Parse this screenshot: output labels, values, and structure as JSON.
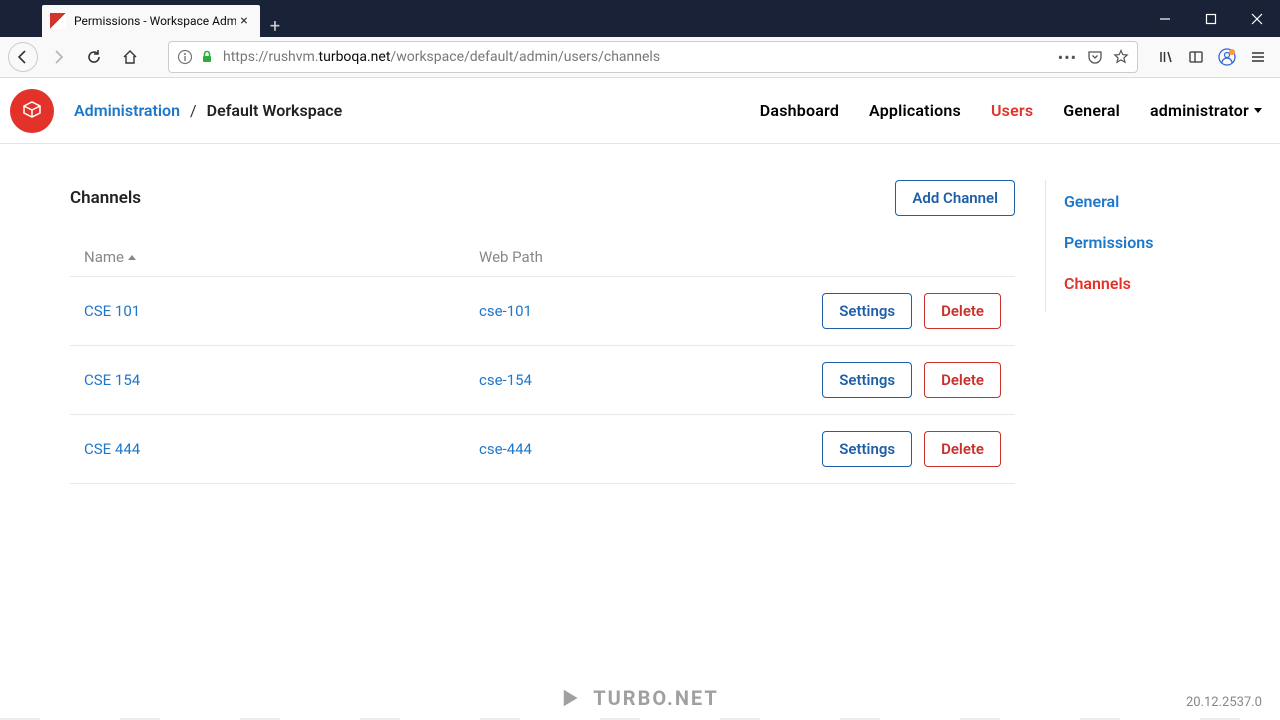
{
  "browser": {
    "tab_title": "Permissions - Workspace Admi",
    "url_prefix": "https://rushvm.",
    "url_host": "turboqa.net",
    "url_path": "/workspace/default/admin/users/channels"
  },
  "breadcrumb": {
    "admin": "Administration",
    "current": "Default Workspace"
  },
  "nav": {
    "dashboard": "Dashboard",
    "applications": "Applications",
    "users": "Users",
    "general": "General",
    "user": "administrator"
  },
  "page": {
    "title": "Channels",
    "add_label": "Add Channel",
    "col_name": "Name",
    "col_path": "Web Path",
    "settings_label": "Settings",
    "delete_label": "Delete"
  },
  "rows": [
    {
      "name": "CSE 101",
      "path": "cse-101"
    },
    {
      "name": "CSE 154",
      "path": "cse-154"
    },
    {
      "name": "CSE 444",
      "path": "cse-444"
    }
  ],
  "sidebar": {
    "general": "General",
    "permissions": "Permissions",
    "channels": "Channels"
  },
  "footer": {
    "brand": "TURBO.NET",
    "version": "20.12.2537.0"
  }
}
